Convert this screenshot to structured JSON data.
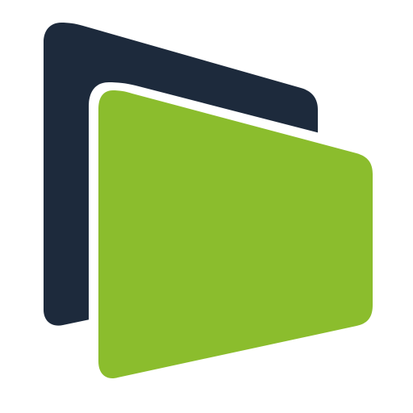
{
  "logo": {
    "icon": "layered-cards-logo-icon",
    "colors": {
      "back_panel": "#1d2a3c",
      "front_panel": "#8bbd2d",
      "outline": "#ffffff",
      "background": "#ffffff"
    }
  }
}
